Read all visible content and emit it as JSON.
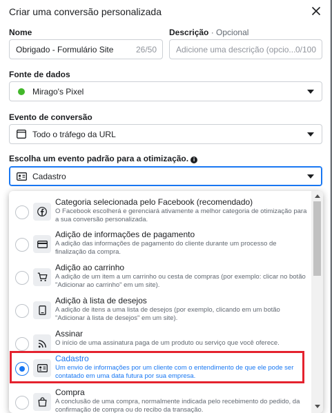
{
  "modal": {
    "title": "Criar uma conversão personalizada"
  },
  "form": {
    "name_label": "Nome",
    "name_value": "Obrigado - Formulário Site",
    "name_count": "26/50",
    "desc_label": "Descrição",
    "desc_optional": "· Opcional",
    "desc_placeholder": "Adicione uma descrição (opcio...",
    "desc_count": "0/100",
    "source_label": "Fonte de dados",
    "source_value": "Mirago's Pixel",
    "source_status_color": "#42b72a",
    "event_label": "Evento de conversão",
    "event_value": "Todo o tráfego da URL",
    "optimize_label": "Escolha um evento padrão para a otimização.",
    "optimize_value": "Cadastro"
  },
  "dropdown": {
    "options": [
      {
        "icon": "facebook-icon",
        "title": "Categoria selecionada pelo Facebook (recomendado)",
        "desc": "O Facebook escolherá e gerenciará ativamente a melhor categoria de otimização para a sua conversão personalizada.",
        "selected": false
      },
      {
        "icon": "credit-card-icon",
        "title": "Adição de informações de pagamento",
        "desc": "A adição das informações de pagamento do cliente durante um processo de finalização da compra.",
        "selected": false
      },
      {
        "icon": "shopping-cart-icon",
        "title": "Adição ao carrinho",
        "desc": "A adição de um item a um carrinho ou cesta de compras (por exemplo: clicar no botão \"Adicionar ao carrinho\" em um site).",
        "selected": false
      },
      {
        "icon": "bookmark-icon",
        "title": "Adição à lista de desejos",
        "desc": "A adição de itens a uma lista de desejos (por exemplo, clicando em um botão \"Adicionar à lista de desejos\" em um site).",
        "selected": false
      },
      {
        "icon": "rss-icon",
        "title": "Assinar",
        "desc": "O início de uma assinatura paga de um produto ou serviço que você oferece.",
        "selected": false
      },
      {
        "icon": "id-card-icon",
        "title": "Cadastro",
        "desc": "Um envio de informações por um cliente com o entendimento de que ele pode ser contatado em uma data futura por sua empresa.",
        "selected": true
      },
      {
        "icon": "shopping-bag-icon",
        "title": "Compra",
        "desc": "A conclusão de uma compra, normalmente indicada pelo recebimento do pedido, da confirmação de compra ou do recibo da transação.",
        "selected": false
      }
    ]
  },
  "colors": {
    "accent": "#1877f2",
    "highlight_border": "#e4222e"
  }
}
